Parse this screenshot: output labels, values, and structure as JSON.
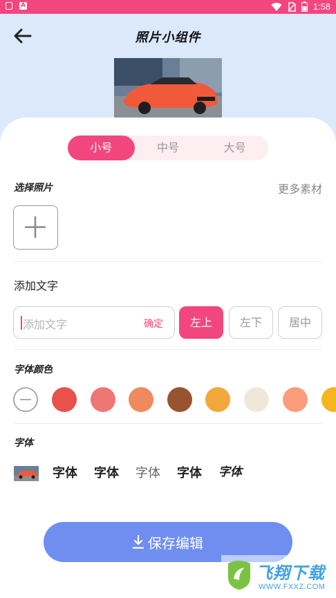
{
  "status_bar": {
    "time": "1:58",
    "left_icons": [
      "notification-icon",
      "a-icon"
    ],
    "right_icons": [
      "wifi-icon",
      "no-sim-icon",
      "battery-icon"
    ]
  },
  "header": {
    "title": "照片小组件",
    "back_icon": "arrow-left-icon"
  },
  "size_tabs": [
    {
      "label": "小号",
      "active": true
    },
    {
      "label": "中号",
      "active": false
    },
    {
      "label": "大号",
      "active": false
    }
  ],
  "photo_section": {
    "title": "选择照片",
    "more_label": "更多素材",
    "add_icon": "plus-icon"
  },
  "text_section": {
    "title": "添加文字",
    "input_placeholder": "添加文字",
    "input_value": "",
    "confirm_label": "确定",
    "positions": [
      {
        "label": "左上",
        "active": true
      },
      {
        "label": "左下",
        "active": false
      },
      {
        "label": "居中",
        "active": false
      }
    ]
  },
  "color_section": {
    "title": "字体颜色",
    "colors": [
      "#e8524a",
      "#f07676",
      "#ee8a5e",
      "#99532f",
      "#f2a83c",
      "#efe8d8",
      "#fb9d7a",
      "#f6b51e"
    ]
  },
  "font_section": {
    "title": "字体",
    "options": [
      "字体",
      "字体",
      "字体",
      "字体",
      "字体"
    ]
  },
  "save_button": {
    "label": "保存编辑",
    "icon": "download-icon"
  },
  "watermark": {
    "text": "飞翔下载",
    "url": "WWW.FXXZ.COM"
  },
  "colors": {
    "accent": "#f2477e",
    "primary_button": "#6f8ef0",
    "background": "#dbe9fb"
  }
}
